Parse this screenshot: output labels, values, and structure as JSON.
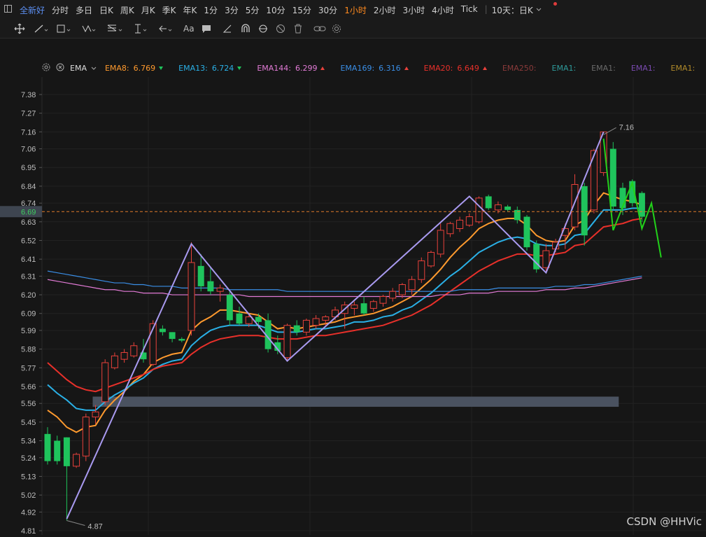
{
  "toolbar": {
    "tabs": [
      "全新好",
      "分时",
      "多日",
      "日K",
      "周K",
      "月K",
      "季K",
      "年K",
      "1分",
      "3分",
      "5分",
      "10分",
      "15分",
      "30分",
      "1小时",
      "2小时",
      "3小时",
      "4小时",
      "Tick",
      "10天：日K"
    ],
    "active_tab": "1小时",
    "stock_name": "全新好",
    "draw_tools_text": "Aa"
  },
  "ema_bar": {
    "label": "EMA",
    "items": [
      {
        "name": "EMA8:",
        "value": "6.769",
        "color": "#ff9a2e",
        "dir": "down"
      },
      {
        "name": "EMA13:",
        "value": "6.724",
        "color": "#2ab0e6",
        "dir": "down"
      },
      {
        "name": "EMA144:",
        "value": "6.299",
        "color": "#e27bd6",
        "dir": "up"
      },
      {
        "name": "EMA169:",
        "value": "6.316",
        "color": "#3a8ee6",
        "dir": "up"
      },
      {
        "name": "EMA20:",
        "value": "6.649",
        "color": "#e8302a",
        "dir": "up"
      },
      {
        "name": "EMA250:",
        "value": "",
        "color": "#8a3a3a",
        "dir": ""
      },
      {
        "name": "EMA1:",
        "value": "",
        "color": "#2e9a9a",
        "dir": ""
      },
      {
        "name": "EMA1:",
        "value": "",
        "color": "#6a6a6a",
        "dir": ""
      },
      {
        "name": "EMA1:",
        "value": "",
        "color": "#7a4ab0",
        "dir": ""
      },
      {
        "name": "EMA1:",
        "value": "",
        "color": "#b08a2a",
        "dir": ""
      }
    ]
  },
  "chart_data": {
    "type": "candlestick",
    "ylim": [
      4.81,
      7.44
    ],
    "y_ticks": [
      "7.38",
      "7.27",
      "7.16",
      "7.06",
      "6.95",
      "6.84",
      "6.74",
      "6.63",
      "6.52",
      "6.41",
      "6.31",
      "6.20",
      "6.09",
      "5.99",
      "5.88",
      "5.77",
      "5.66",
      "5.56",
      "5.45",
      "5.34",
      "5.24",
      "5.13",
      "5.02",
      "4.92",
      "4.81"
    ],
    "y_tick_values": [
      7.38,
      7.27,
      7.16,
      7.06,
      6.95,
      6.84,
      6.74,
      6.63,
      6.52,
      6.41,
      6.31,
      6.2,
      6.09,
      5.99,
      5.88,
      5.77,
      5.66,
      5.56,
      5.45,
      5.34,
      5.24,
      5.13,
      5.02,
      4.92,
      4.81
    ],
    "current_price": "6.69",
    "current_price_value": 6.69,
    "high_label": "7.16",
    "low_label": "4.87",
    "candles": [
      {
        "o": 5.38,
        "h": 5.42,
        "l": 5.2,
        "c": 5.22
      },
      {
        "o": 5.34,
        "h": 5.37,
        "l": 5.2,
        "c": 5.22
      },
      {
        "o": 5.36,
        "h": 5.36,
        "l": 4.87,
        "c": 5.19
      },
      {
        "o": 5.19,
        "h": 5.27,
        "l": 5.18,
        "c": 5.26
      },
      {
        "o": 5.25,
        "h": 5.5,
        "l": 5.22,
        "c": 5.48
      },
      {
        "o": 5.48,
        "h": 5.55,
        "l": 5.44,
        "c": 5.51
      },
      {
        "o": 5.57,
        "h": 5.82,
        "l": 5.55,
        "c": 5.8
      },
      {
        "o": 5.77,
        "h": 5.86,
        "l": 5.76,
        "c": 5.84
      },
      {
        "o": 5.82,
        "h": 5.88,
        "l": 5.8,
        "c": 5.86
      },
      {
        "o": 5.84,
        "h": 5.92,
        "l": 5.83,
        "c": 5.9
      },
      {
        "o": 5.86,
        "h": 5.94,
        "l": 5.8,
        "c": 5.82
      },
      {
        "o": 5.79,
        "h": 6.05,
        "l": 5.78,
        "c": 6.03
      },
      {
        "o": 6.0,
        "h": 6.02,
        "l": 5.96,
        "c": 5.98
      },
      {
        "o": 5.98,
        "h": 5.98,
        "l": 5.92,
        "c": 5.94
      },
      {
        "o": 5.94,
        "h": 5.95,
        "l": 5.92,
        "c": 5.93
      },
      {
        "o": 5.99,
        "h": 6.51,
        "l": 5.96,
        "c": 6.39
      },
      {
        "o": 6.37,
        "h": 6.44,
        "l": 6.22,
        "c": 6.25
      },
      {
        "o": 6.28,
        "h": 6.36,
        "l": 6.2,
        "c": 6.22
      },
      {
        "o": 6.22,
        "h": 6.26,
        "l": 6.16,
        "c": 6.24
      },
      {
        "o": 6.2,
        "h": 6.22,
        "l": 6.02,
        "c": 6.05
      },
      {
        "o": 6.09,
        "h": 6.13,
        "l": 6.02,
        "c": 6.03
      },
      {
        "o": 6.03,
        "h": 6.09,
        "l": 6.01,
        "c": 6.07
      },
      {
        "o": 6.07,
        "h": 6.09,
        "l": 6.0,
        "c": 6.04
      },
      {
        "o": 6.05,
        "h": 6.09,
        "l": 5.86,
        "c": 5.88
      },
      {
        "o": 5.92,
        "h": 5.96,
        "l": 5.85,
        "c": 5.87
      },
      {
        "o": 5.83,
        "h": 6.03,
        "l": 5.81,
        "c": 6.02
      },
      {
        "o": 6.02,
        "h": 6.05,
        "l": 5.96,
        "c": 5.98
      },
      {
        "o": 5.98,
        "h": 6.06,
        "l": 5.96,
        "c": 6.05
      },
      {
        "o": 6.02,
        "h": 6.08,
        "l": 6.0,
        "c": 6.06
      },
      {
        "o": 6.05,
        "h": 6.08,
        "l": 6.02,
        "c": 6.07
      },
      {
        "o": 6.07,
        "h": 6.13,
        "l": 6.05,
        "c": 6.11
      },
      {
        "o": 6.09,
        "h": 6.16,
        "l": 6.0,
        "c": 6.14
      },
      {
        "o": 6.12,
        "h": 6.16,
        "l": 6.08,
        "c": 6.14
      },
      {
        "o": 6.15,
        "h": 6.19,
        "l": 6.08,
        "c": 6.09
      },
      {
        "o": 6.12,
        "h": 6.17,
        "l": 6.1,
        "c": 6.16
      },
      {
        "o": 6.15,
        "h": 6.2,
        "l": 6.13,
        "c": 6.19
      },
      {
        "o": 6.18,
        "h": 6.24,
        "l": 6.16,
        "c": 6.22
      },
      {
        "o": 6.2,
        "h": 6.27,
        "l": 6.18,
        "c": 6.26
      },
      {
        "o": 6.23,
        "h": 6.31,
        "l": 6.2,
        "c": 6.29
      },
      {
        "o": 6.29,
        "h": 6.42,
        "l": 6.27,
        "c": 6.4
      },
      {
        "o": 6.37,
        "h": 6.46,
        "l": 6.36,
        "c": 6.45
      },
      {
        "o": 6.44,
        "h": 6.62,
        "l": 6.42,
        "c": 6.58
      },
      {
        "o": 6.56,
        "h": 6.63,
        "l": 6.54,
        "c": 6.62
      },
      {
        "o": 6.59,
        "h": 6.66,
        "l": 6.57,
        "c": 6.64
      },
      {
        "o": 6.61,
        "h": 6.68,
        "l": 6.6,
        "c": 6.66
      },
      {
        "o": 6.63,
        "h": 6.78,
        "l": 6.62,
        "c": 6.77
      },
      {
        "o": 6.78,
        "h": 6.79,
        "l": 6.7,
        "c": 6.71
      },
      {
        "o": 6.7,
        "h": 6.75,
        "l": 6.68,
        "c": 6.73
      },
      {
        "o": 6.72,
        "h": 6.73,
        "l": 6.69,
        "c": 6.7
      },
      {
        "o": 6.7,
        "h": 6.72,
        "l": 6.62,
        "c": 6.64
      },
      {
        "o": 6.66,
        "h": 6.67,
        "l": 6.46,
        "c": 6.48
      },
      {
        "o": 6.5,
        "h": 6.52,
        "l": 6.33,
        "c": 6.35
      },
      {
        "o": 6.36,
        "h": 6.5,
        "l": 6.34,
        "c": 6.46
      },
      {
        "o": 6.47,
        "h": 6.53,
        "l": 6.45,
        "c": 6.51
      },
      {
        "o": 6.55,
        "h": 6.62,
        "l": 6.47,
        "c": 6.59
      },
      {
        "o": 6.6,
        "h": 6.91,
        "l": 6.58,
        "c": 6.85
      },
      {
        "o": 6.84,
        "h": 6.86,
        "l": 6.49,
        "c": 6.55
      },
      {
        "o": 6.7,
        "h": 7.06,
        "l": 6.68,
        "c": 7.05
      },
      {
        "o": 6.92,
        "h": 7.16,
        "l": 6.9,
        "c": 7.16
      },
      {
        "o": 7.06,
        "h": 7.1,
        "l": 6.7,
        "c": 6.72
      },
      {
        "o": 6.83,
        "h": 6.86,
        "l": 6.67,
        "c": 6.71
      },
      {
        "o": 6.87,
        "h": 6.88,
        "l": 6.72,
        "c": 6.74
      },
      {
        "o": 6.8,
        "h": 6.81,
        "l": 6.63,
        "c": 6.66
      }
    ],
    "series": [
      {
        "name": "EMA8",
        "color": "#ff9a2e",
        "values": [
          5.52,
          5.48,
          5.42,
          5.39,
          5.42,
          5.43,
          5.52,
          5.58,
          5.63,
          5.69,
          5.73,
          5.8,
          5.83,
          5.85,
          5.86,
          5.99,
          6.04,
          6.07,
          6.11,
          6.11,
          6.1,
          6.09,
          6.08,
          6.04,
          6.0,
          6.01,
          6.0,
          6.01,
          6.02,
          6.03,
          6.04,
          6.06,
          6.07,
          6.08,
          6.09,
          6.11,
          6.13,
          6.16,
          6.19,
          6.24,
          6.29,
          6.35,
          6.42,
          6.48,
          6.53,
          6.59,
          6.62,
          6.64,
          6.65,
          6.65,
          6.61,
          6.55,
          6.52,
          6.51,
          6.52,
          6.61,
          6.64,
          6.73,
          6.8,
          6.78,
          6.76,
          6.75,
          6.73
        ]
      },
      {
        "name": "EMA13",
        "color": "#2ab0e6",
        "values": [
          5.67,
          5.62,
          5.58,
          5.53,
          5.52,
          5.52,
          5.57,
          5.61,
          5.64,
          5.68,
          5.71,
          5.76,
          5.79,
          5.81,
          5.82,
          5.9,
          5.95,
          5.99,
          6.01,
          6.02,
          6.02,
          6.02,
          6.02,
          6.0,
          5.98,
          5.98,
          5.98,
          5.99,
          6.0,
          6.0,
          6.01,
          6.02,
          6.04,
          6.04,
          6.05,
          6.07,
          6.08,
          6.11,
          6.13,
          6.17,
          6.21,
          6.26,
          6.31,
          6.35,
          6.4,
          6.45,
          6.48,
          6.51,
          6.53,
          6.54,
          6.53,
          6.5,
          6.49,
          6.49,
          6.5,
          6.55,
          6.56,
          6.63,
          6.7,
          6.7,
          6.7,
          6.71,
          6.71
        ]
      },
      {
        "name": "EMA20",
        "color": "#e8302a",
        "values": [
          5.8,
          5.75,
          5.7,
          5.66,
          5.64,
          5.63,
          5.65,
          5.67,
          5.69,
          5.71,
          5.73,
          5.76,
          5.78,
          5.79,
          5.8,
          5.85,
          5.89,
          5.92,
          5.94,
          5.95,
          5.96,
          5.96,
          5.96,
          5.95,
          5.94,
          5.94,
          5.94,
          5.95,
          5.96,
          5.96,
          5.97,
          5.98,
          5.99,
          6.0,
          6.01,
          6.02,
          6.04,
          6.06,
          6.08,
          6.11,
          6.14,
          6.18,
          6.22,
          6.26,
          6.3,
          6.34,
          6.37,
          6.4,
          6.42,
          6.44,
          6.44,
          6.43,
          6.43,
          6.44,
          6.45,
          6.49,
          6.5,
          6.55,
          6.6,
          6.61,
          6.62,
          6.64,
          6.65
        ]
      },
      {
        "name": "EMA144",
        "color": "#e27bd6",
        "values": [
          6.29,
          6.28,
          6.27,
          6.26,
          6.25,
          6.24,
          6.23,
          6.23,
          6.22,
          6.22,
          6.21,
          6.21,
          6.21,
          6.2,
          6.2,
          6.2,
          6.2,
          6.2,
          6.2,
          6.2,
          6.2,
          6.19,
          6.19,
          6.19,
          6.19,
          6.19,
          6.19,
          6.19,
          6.19,
          6.19,
          6.19,
          6.19,
          6.19,
          6.19,
          6.19,
          6.19,
          6.19,
          6.19,
          6.19,
          6.19,
          6.19,
          6.2,
          6.2,
          6.2,
          6.21,
          6.21,
          6.21,
          6.22,
          6.22,
          6.22,
          6.22,
          6.22,
          6.23,
          6.23,
          6.23,
          6.24,
          6.24,
          6.25,
          6.26,
          6.27,
          6.28,
          6.29,
          6.3
        ]
      },
      {
        "name": "EMA169",
        "color": "#3a8ee6",
        "values": [
          6.34,
          6.33,
          6.32,
          6.31,
          6.3,
          6.29,
          6.28,
          6.27,
          6.27,
          6.26,
          6.26,
          6.25,
          6.25,
          6.25,
          6.24,
          6.24,
          6.24,
          6.24,
          6.24,
          6.23,
          6.23,
          6.23,
          6.23,
          6.23,
          6.23,
          6.22,
          6.22,
          6.22,
          6.22,
          6.22,
          6.22,
          6.22,
          6.22,
          6.22,
          6.22,
          6.22,
          6.22,
          6.22,
          6.22,
          6.22,
          6.22,
          6.22,
          6.22,
          6.23,
          6.23,
          6.23,
          6.23,
          6.24,
          6.24,
          6.24,
          6.24,
          6.24,
          6.24,
          6.25,
          6.25,
          6.25,
          6.26,
          6.26,
          6.27,
          6.28,
          6.29,
          6.3,
          6.31
        ]
      }
    ],
    "zigzag_purple": [
      [
        2,
        4.88
      ],
      [
        15,
        6.5
      ],
      [
        25,
        5.81
      ],
      [
        44,
        6.78
      ],
      [
        52,
        6.33
      ],
      [
        58,
        7.16
      ]
    ],
    "zigzag_green": [
      [
        58,
        7.12
      ],
      [
        59,
        6.58
      ],
      [
        61,
        6.86
      ],
      [
        62,
        6.59
      ],
      [
        63,
        6.74
      ],
      [
        64,
        6.42
      ]
    ],
    "support_zone": {
      "from_index": 5,
      "to_index": 59,
      "low": 5.54,
      "high": 5.6
    },
    "watermark": "CSDN @HHVic"
  }
}
